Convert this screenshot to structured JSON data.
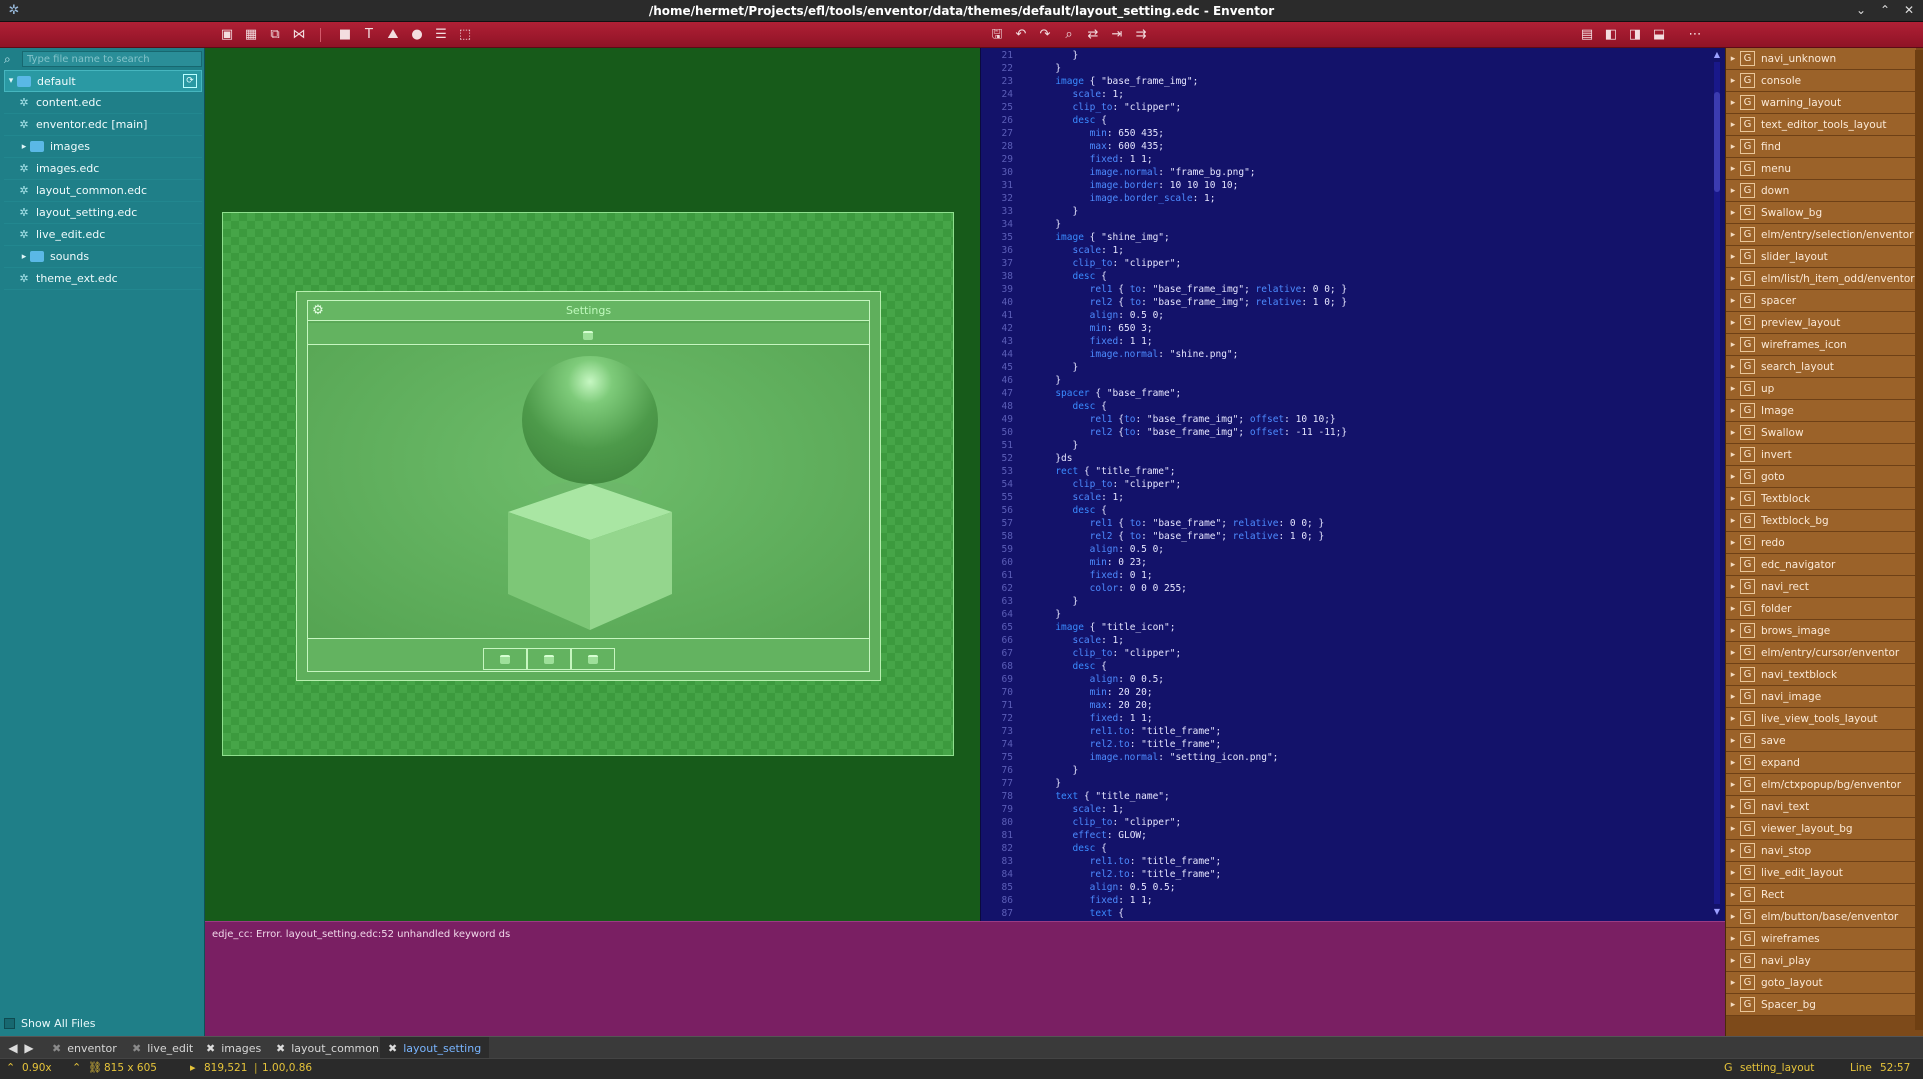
{
  "window": {
    "title": "/home/hermet/Projects/efl/tools/enventor/data/themes/default/layout_setting.edc - Enventor",
    "controls": [
      "chevron-down-icon",
      "maximize-icon",
      "close-icon"
    ]
  },
  "toolbar": {
    "left_icons": [
      "layout-icon",
      "grid-icon",
      "copy-icon",
      "mirror-icon",
      "rect-icon",
      "text-icon",
      "image-icon",
      "swallow-icon",
      "textblock-icon",
      "spacer-icon"
    ],
    "middle_icons": [
      "save-icon",
      "undo-icon",
      "redo-icon",
      "find-icon",
      "goto-icon",
      "indent-icon",
      "insert-icon"
    ],
    "right_icons": [
      "view-split-icon",
      "panel-left-icon",
      "panel-right-icon",
      "panel-bottom-icon",
      "more-icon"
    ]
  },
  "sidebar": {
    "search_placeholder": "Type file name to search",
    "root": "default",
    "items": [
      {
        "label": "content.edc",
        "type": "file"
      },
      {
        "label": "enventor.edc [main]",
        "type": "file"
      },
      {
        "label": "images",
        "type": "folder"
      },
      {
        "label": "images.edc",
        "type": "file"
      },
      {
        "label": "layout_common.edc",
        "type": "file"
      },
      {
        "label": "layout_setting.edc",
        "type": "file"
      },
      {
        "label": "live_edit.edc",
        "type": "file"
      },
      {
        "label": "sounds",
        "type": "folder"
      },
      {
        "label": "theme_ext.edc",
        "type": "file"
      }
    ],
    "show_all_files": "Show All Files"
  },
  "preview": {
    "settings_title": "Settings"
  },
  "editor": {
    "lines": [
      {
        "n": "21",
        "t": "         }"
      },
      {
        "n": "22",
        "t": "      }"
      },
      {
        "n": "23",
        "t": "      image { \"base_frame_img\";"
      },
      {
        "n": "24",
        "t": "         scale: 1;"
      },
      {
        "n": "25",
        "t": "         clip_to: \"clipper\";"
      },
      {
        "n": "26",
        "t": "         desc {"
      },
      {
        "n": "27",
        "t": "            min: 650 435;"
      },
      {
        "n": "28",
        "t": "            max: 600 435;"
      },
      {
        "n": "29",
        "t": "            fixed: 1 1;"
      },
      {
        "n": "30",
        "t": "            image.normal: \"frame_bg.png\";"
      },
      {
        "n": "31",
        "t": "            image.border: 10 10 10 10;"
      },
      {
        "n": "32",
        "t": "            image.border_scale: 1;"
      },
      {
        "n": "33",
        "t": "         }"
      },
      {
        "n": "34",
        "t": "      }"
      },
      {
        "n": "35",
        "t": "      image { \"shine_img\";"
      },
      {
        "n": "36",
        "t": "         scale: 1;"
      },
      {
        "n": "37",
        "t": "         clip_to: \"clipper\";"
      },
      {
        "n": "38",
        "t": "         desc {"
      },
      {
        "n": "39",
        "t": "            rel1 { to: \"base_frame_img\"; relative: 0 0; }"
      },
      {
        "n": "40",
        "t": "            rel2 { to: \"base_frame_img\"; relative: 1 0; }"
      },
      {
        "n": "41",
        "t": "            align: 0.5 0;"
      },
      {
        "n": "42",
        "t": "            min: 650 3;"
      },
      {
        "n": "43",
        "t": "            fixed: 1 1;"
      },
      {
        "n": "44",
        "t": "            image.normal: \"shine.png\";"
      },
      {
        "n": "45",
        "t": "         }"
      },
      {
        "n": "46",
        "t": "      }"
      },
      {
        "n": "47",
        "t": "      spacer { \"base_frame\";"
      },
      {
        "n": "48",
        "t": "         desc {"
      },
      {
        "n": "49",
        "t": "            rel1 {to: \"base_frame_img\"; offset: 10 10;}"
      },
      {
        "n": "50",
        "t": "            rel2 {to: \"base_frame_img\"; offset: -11 -11;}"
      },
      {
        "n": "51",
        "t": "         }"
      },
      {
        "n": "52",
        "t": "      }ds"
      },
      {
        "n": "53",
        "t": "      rect { \"title_frame\";"
      },
      {
        "n": "54",
        "t": "         clip_to: \"clipper\";"
      },
      {
        "n": "55",
        "t": "         scale: 1;"
      },
      {
        "n": "56",
        "t": "         desc {"
      },
      {
        "n": "57",
        "t": "            rel1 { to: \"base_frame\"; relative: 0 0; }"
      },
      {
        "n": "58",
        "t": "            rel2 { to: \"base_frame\"; relative: 1 0; }"
      },
      {
        "n": "59",
        "t": "            align: 0.5 0;"
      },
      {
        "n": "60",
        "t": "            min: 0 23;"
      },
      {
        "n": "61",
        "t": "            fixed: 0 1;"
      },
      {
        "n": "62",
        "t": "            color: 0 0 0 255;"
      },
      {
        "n": "63",
        "t": "         }"
      },
      {
        "n": "64",
        "t": "      }"
      },
      {
        "n": "65",
        "t": "      image { \"title_icon\";"
      },
      {
        "n": "66",
        "t": "         scale: 1;"
      },
      {
        "n": "67",
        "t": "         clip_to: \"clipper\";"
      },
      {
        "n": "68",
        "t": "         desc {"
      },
      {
        "n": "69",
        "t": "            align: 0 0.5;"
      },
      {
        "n": "70",
        "t": "            min: 20 20;"
      },
      {
        "n": "71",
        "t": "            max: 20 20;"
      },
      {
        "n": "72",
        "t": "            fixed: 1 1;"
      },
      {
        "n": "73",
        "t": "            rel1.to: \"title_frame\";"
      },
      {
        "n": "74",
        "t": "            rel2.to: \"title_frame\";"
      },
      {
        "n": "75",
        "t": "            image.normal: \"setting_icon.png\";"
      },
      {
        "n": "76",
        "t": "         }"
      },
      {
        "n": "77",
        "t": "      }"
      },
      {
        "n": "78",
        "t": "      text { \"title_name\";"
      },
      {
        "n": "79",
        "t": "         scale: 1;"
      },
      {
        "n": "80",
        "t": "         clip_to: \"clipper\";"
      },
      {
        "n": "81",
        "t": "         effect: GLOW;"
      },
      {
        "n": "82",
        "t": "         desc {"
      },
      {
        "n": "83",
        "t": "            rel1.to: \"title_frame\";"
      },
      {
        "n": "84",
        "t": "            rel2.to: \"title_frame\";"
      },
      {
        "n": "85",
        "t": "            align: 0.5 0.5;"
      },
      {
        "n": "86",
        "t": "            fixed: 1 1;"
      },
      {
        "n": "87",
        "t": "            text {"
      }
    ]
  },
  "console": {
    "message": "edje_cc: Error. layout_setting.edc:52 unhandled keyword ds"
  },
  "groups": [
    "navi_unknown",
    "console",
    "warning_layout",
    "text_editor_tools_layout",
    "find",
    "menu",
    "down",
    "Swallow_bg",
    "elm/entry/selection/enventor",
    "slider_layout",
    "elm/list/h_item_odd/enventor",
    "spacer",
    "preview_layout",
    "wireframes_icon",
    "search_layout",
    "up",
    "Image",
    "Swallow",
    "invert",
    "goto",
    "Textblock",
    "Textblock_bg",
    "redo",
    "edc_navigator",
    "navi_rect",
    "folder",
    "brows_image",
    "elm/entry/cursor/enventor",
    "navi_textblock",
    "navi_image",
    "live_view_tools_layout",
    "save",
    "expand",
    "elm/ctxpopup/bg/enventor",
    "navi_text",
    "viewer_layout_bg",
    "navi_stop",
    "live_edit_layout",
    "Rect",
    "elm/button/base/enventor",
    "wireframes",
    "navi_play",
    "goto_layout",
    "Spacer_bg"
  ],
  "tabs": [
    {
      "label": "enventor",
      "active": false
    },
    {
      "label": "live_edit",
      "active": false
    },
    {
      "label": "images",
      "active": false
    },
    {
      "label": "layout_common",
      "active": false
    },
    {
      "label": "layout_setting",
      "active": true
    }
  ],
  "status": {
    "zoom": "0.90x",
    "size": "815 x 605",
    "cursor_pos": "819,521",
    "relative": "1.00,0.86",
    "group": "setting_layout",
    "line_label": "Line",
    "line_pos": "52:57"
  },
  "colors": {
    "toolbar": "#a6192e",
    "sidebar": "#1f7f88",
    "preview_bg": "#175b1a",
    "editor_bg": "#13126a",
    "console_bg": "#7a1f63",
    "right_panel": "#9b6229",
    "status_text": "#e5c33a"
  }
}
